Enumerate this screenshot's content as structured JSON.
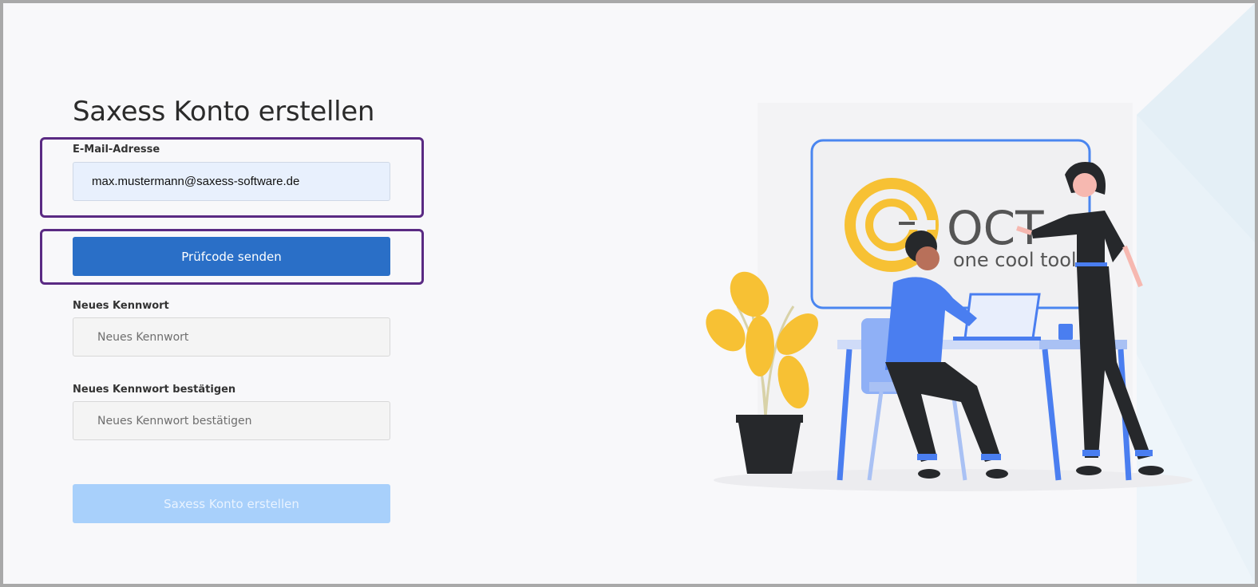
{
  "page": {
    "title": "Saxess Konto erstellen"
  },
  "form": {
    "email_label": "E-Mail-Adresse",
    "email_value": "max.mustermann@saxess-software.de",
    "send_code_button": "Prüfcode senden",
    "new_password_label": "Neues Kennwort",
    "new_password_placeholder": "Neues Kennwort",
    "confirm_password_label": "Neues Kennwort bestätigen",
    "confirm_password_placeholder": "Neues Kennwort bestätigen",
    "create_account_button": "Saxess Konto erstellen"
  },
  "illustration": {
    "logo_text": "OCT",
    "logo_tagline": "one cool tool"
  },
  "colors": {
    "primary": "#2a6fc7",
    "disabled": "#a8d0fb",
    "highlight": "#5a2a83",
    "logo_yellow": "#f7c134"
  }
}
